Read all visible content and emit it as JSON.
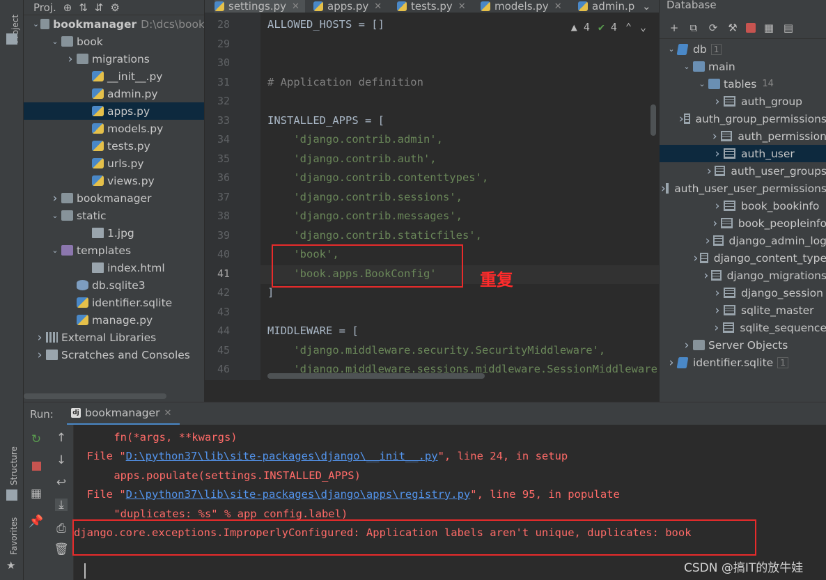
{
  "side_strip": {
    "project_label": "Project",
    "structure_label": "Structure",
    "favorites_label": "Favorites"
  },
  "project": {
    "header_label": "Proj.",
    "tree": [
      {
        "label": "bookmanager",
        "path": "D:\\dcs\\book",
        "icon": "folder-icon",
        "depth": 0,
        "expanded": true
      },
      {
        "label": "book",
        "icon": "folder-icon",
        "depth": 1,
        "expanded": true
      },
      {
        "label": "migrations",
        "icon": "folder-icon",
        "depth": 2,
        "expanded": false
      },
      {
        "label": "__init__.py",
        "icon": "python-file-icon",
        "depth": 3
      },
      {
        "label": "admin.py",
        "icon": "python-file-icon",
        "depth": 3
      },
      {
        "label": "apps.py",
        "icon": "python-file-icon",
        "depth": 3,
        "selected": true
      },
      {
        "label": "models.py",
        "icon": "python-file-icon",
        "depth": 3
      },
      {
        "label": "tests.py",
        "icon": "python-file-icon",
        "depth": 3
      },
      {
        "label": "urls.py",
        "icon": "python-file-icon",
        "depth": 3
      },
      {
        "label": "views.py",
        "icon": "python-file-icon",
        "depth": 3
      },
      {
        "label": "bookmanager",
        "icon": "folder-icon",
        "depth": 1,
        "expanded": false
      },
      {
        "label": "static",
        "icon": "folder-icon",
        "depth": 1,
        "expanded": true
      },
      {
        "label": "1.jpg",
        "icon": "image-file-icon",
        "depth": 3
      },
      {
        "label": "templates",
        "icon": "folder-icon",
        "depth": 1,
        "expanded": true
      },
      {
        "label": "index.html",
        "icon": "html-file-icon",
        "depth": 3
      },
      {
        "label": "db.sqlite3",
        "icon": "database-file-icon",
        "depth": 2
      },
      {
        "label": "identifier.sqlite",
        "icon": "unknown-file-icon",
        "depth": 2
      },
      {
        "label": "manage.py",
        "icon": "python-file-icon",
        "depth": 2
      },
      {
        "label": "External Libraries",
        "icon": "library-icon",
        "depth": 0,
        "expanded": false
      },
      {
        "label": "Scratches and Consoles",
        "icon": "scratches-icon",
        "depth": 0,
        "expanded": false
      }
    ]
  },
  "editor": {
    "tabs": [
      "settings.py",
      "apps.py",
      "tests.py",
      "models.py",
      "admin.p"
    ],
    "active_tab": "settings.py",
    "inspections": {
      "warnings": "4",
      "weak_warnings": "4"
    },
    "lines": [
      {
        "num": "28",
        "text": "ALLOWED_HOSTS = []"
      },
      {
        "num": "29",
        "text": ""
      },
      {
        "num": "30",
        "text": ""
      },
      {
        "num": "31",
        "text": "# Application definition"
      },
      {
        "num": "32",
        "text": ""
      },
      {
        "num": "33",
        "text": "INSTALLED_APPS = ["
      },
      {
        "num": "34",
        "text": "    'django.contrib.admin',"
      },
      {
        "num": "35",
        "text": "    'django.contrib.auth',"
      },
      {
        "num": "36",
        "text": "    'django.contrib.contenttypes',"
      },
      {
        "num": "37",
        "text": "    'django.contrib.sessions',"
      },
      {
        "num": "38",
        "text": "    'django.contrib.messages',"
      },
      {
        "num": "39",
        "text": "    'django.contrib.staticfiles',"
      },
      {
        "num": "40",
        "text": "    'book',"
      },
      {
        "num": "41",
        "text": "    'book.apps.BookConfig'"
      },
      {
        "num": "42",
        "text": "]"
      },
      {
        "num": "43",
        "text": ""
      },
      {
        "num": "44",
        "text": "MIDDLEWARE = ["
      },
      {
        "num": "45",
        "text": "    'django.middleware.security.SecurityMiddleware',"
      },
      {
        "num": "46",
        "text": "    'django.middleware.sessions.middleware.SessionMiddleware',"
      }
    ],
    "current_line": "41",
    "annotation": "重复"
  },
  "database": {
    "title": "Database",
    "tree": [
      {
        "label": "db",
        "badge": "1",
        "icon": "database-icon",
        "depth": 0
      },
      {
        "label": "main",
        "icon": "schema-icon",
        "depth": 1
      },
      {
        "label": "tables",
        "count": "14",
        "icon": "folder-icon",
        "depth": 2
      },
      {
        "label": "auth_group",
        "icon": "table-icon",
        "depth": 3
      },
      {
        "label": "auth_group_permissions",
        "icon": "table-icon",
        "depth": 3
      },
      {
        "label": "auth_permission",
        "icon": "table-icon",
        "depth": 3
      },
      {
        "label": "auth_user",
        "icon": "table-icon",
        "depth": 3,
        "selected": true
      },
      {
        "label": "auth_user_groups",
        "icon": "table-icon",
        "depth": 3
      },
      {
        "label": "auth_user_user_permissions",
        "icon": "table-icon",
        "depth": 3
      },
      {
        "label": "book_bookinfo",
        "icon": "table-icon",
        "depth": 3
      },
      {
        "label": "book_peopleinfo",
        "icon": "table-icon",
        "depth": 3
      },
      {
        "label": "django_admin_log",
        "icon": "table-icon",
        "depth": 3
      },
      {
        "label": "django_content_type",
        "icon": "table-icon",
        "depth": 3
      },
      {
        "label": "django_migrations",
        "icon": "table-icon",
        "depth": 3
      },
      {
        "label": "django_session",
        "icon": "table-icon",
        "depth": 3
      },
      {
        "label": "sqlite_master",
        "icon": "table-icon",
        "depth": 3
      },
      {
        "label": "sqlite_sequence",
        "icon": "table-icon",
        "depth": 3
      },
      {
        "label": "Server Objects",
        "icon": "folder-icon",
        "depth": 1
      },
      {
        "label": "identifier.sqlite",
        "badge": "1",
        "icon": "database-icon",
        "depth": 0
      }
    ]
  },
  "run": {
    "label": "Run:",
    "tab": "bookmanager",
    "console": [
      {
        "pre": "    fn(*args, **kwargs)",
        "link": "",
        "post": ""
      },
      {
        "pre": "  File \"",
        "link": "D:\\python37\\lib\\site-packages\\django\\__init__.py",
        "post": "\", line 24, in setup"
      },
      {
        "pre": "    apps.populate(settings.INSTALLED_APPS)",
        "link": "",
        "post": ""
      },
      {
        "pre": "  File \"",
        "link": "D:\\python37\\lib\\site-packages\\django\\apps\\registry.py",
        "post": "\", line 95, in populate"
      },
      {
        "pre": "    \"duplicates: %s\" % app_config.label)",
        "link": "",
        "post": ""
      },
      {
        "pre": "django.core.exceptions.ImproperlyConfigured: Application labels aren't unique, duplicates: book",
        "link": "",
        "post": ""
      }
    ]
  },
  "watermark": "CSDN @搞IT的放牛娃",
  "colors": {
    "error": "#ff6b68",
    "annotation_red": "#e82b2b",
    "link": "#5394ec",
    "string": "#6a8759",
    "selection": "#0d293e"
  }
}
